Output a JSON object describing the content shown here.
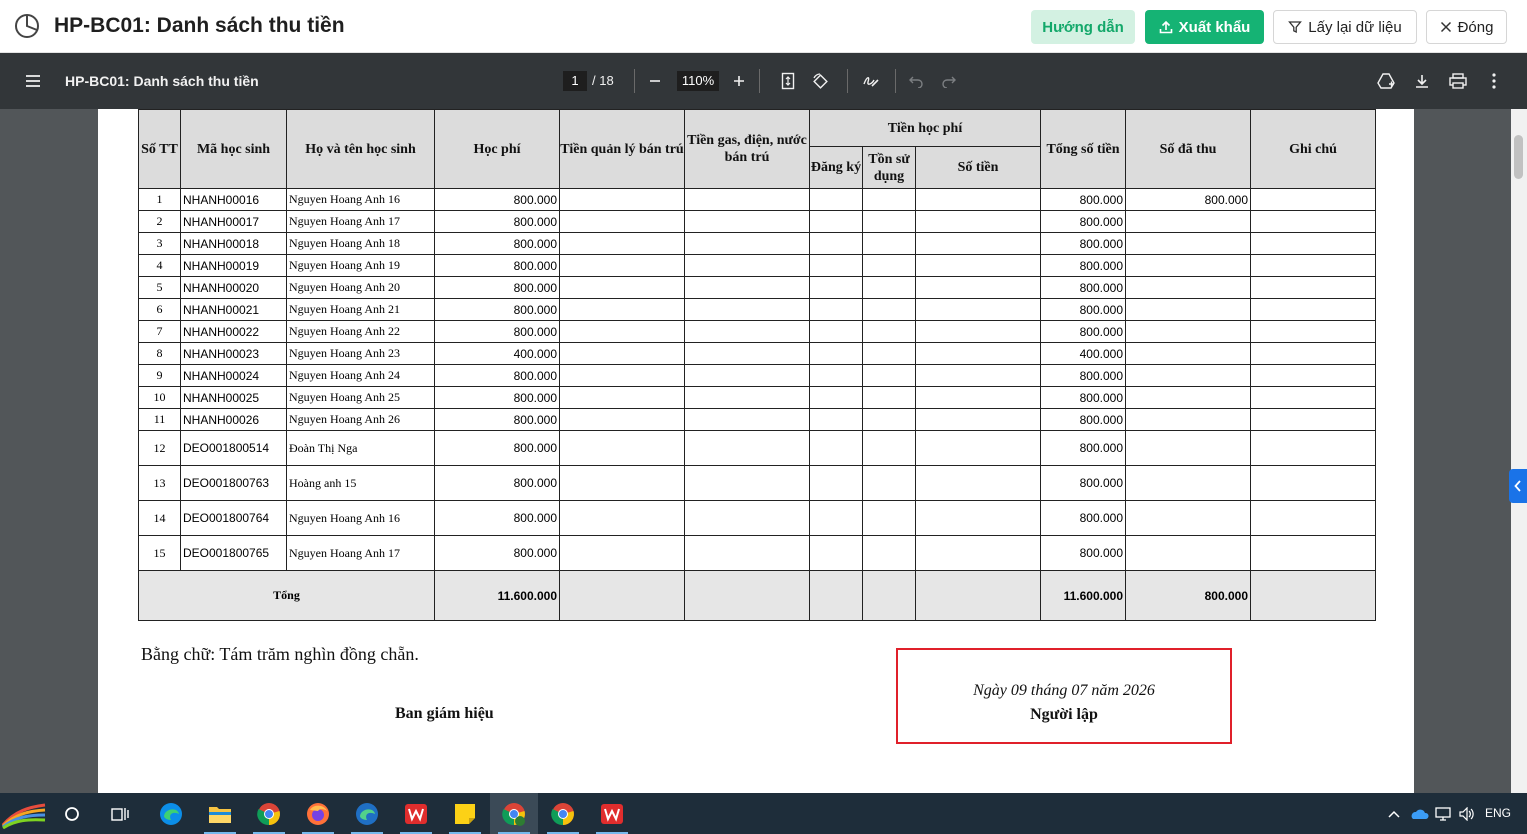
{
  "app": {
    "title": "HP-BC01: Danh sách thu tiền",
    "buttons": {
      "guide": "Hướng dẫn",
      "export": "Xuất khẩu",
      "reload": "Lấy lại dữ liệu",
      "close": "Đóng"
    },
    "colors": {
      "accent": "#15b374",
      "accent_light": "#d3f1e2"
    }
  },
  "viewer": {
    "doc_title": "HP-BC01: Danh sách thu tiền",
    "current_page": "1",
    "page_total": "/ 18",
    "zoom": "110%"
  },
  "table": {
    "headers": {
      "stt": "Số TT",
      "code": "Mã học sinh",
      "name": "Họ và tên học sinh",
      "tuition": "Học phí",
      "boarding": "Tiền quản lý bán trú",
      "gas": "Tiền gas, điện, nước bán trú",
      "study_fee": "Tiền học phí",
      "registered": "Đăng ký",
      "remaining": "Tồn sử dụng",
      "amount": "Số tiền",
      "total": "Tổng số tiền",
      "collected": "Số đã thu",
      "note": "Ghi chú"
    },
    "rows": [
      {
        "stt": "1",
        "code": "NHANH00016",
        "name": "Nguyen Hoang Anh 16",
        "tuition": "800.000",
        "total": "800.000",
        "collected": "800.000"
      },
      {
        "stt": "2",
        "code": "NHANH00017",
        "name": "Nguyen Hoang Anh 17",
        "tuition": "800.000",
        "total": "800.000",
        "collected": ""
      },
      {
        "stt": "3",
        "code": "NHANH00018",
        "name": "Nguyen Hoang Anh 18",
        "tuition": "800.000",
        "total": "800.000",
        "collected": ""
      },
      {
        "stt": "4",
        "code": "NHANH00019",
        "name": "Nguyen Hoang Anh 19",
        "tuition": "800.000",
        "total": "800.000",
        "collected": ""
      },
      {
        "stt": "5",
        "code": "NHANH00020",
        "name": "Nguyen Hoang Anh 20",
        "tuition": "800.000",
        "total": "800.000",
        "collected": ""
      },
      {
        "stt": "6",
        "code": "NHANH00021",
        "name": "Nguyen Hoang Anh 21",
        "tuition": "800.000",
        "total": "800.000",
        "collected": ""
      },
      {
        "stt": "7",
        "code": "NHANH00022",
        "name": "Nguyen Hoang Anh 22",
        "tuition": "800.000",
        "total": "800.000",
        "collected": ""
      },
      {
        "stt": "8",
        "code": "NHANH00023",
        "name": "Nguyen Hoang Anh 23",
        "tuition": "400.000",
        "total": "400.000",
        "collected": ""
      },
      {
        "stt": "9",
        "code": "NHANH00024",
        "name": "Nguyen Hoang Anh 24",
        "tuition": "800.000",
        "total": "800.000",
        "collected": ""
      },
      {
        "stt": "10",
        "code": "NHANH00025",
        "name": "Nguyen Hoang Anh 25",
        "tuition": "800.000",
        "total": "800.000",
        "collected": ""
      },
      {
        "stt": "11",
        "code": "NHANH00026",
        "name": "Nguyen Hoang Anh 26",
        "tuition": "800.000",
        "total": "800.000",
        "collected": ""
      },
      {
        "stt": "12",
        "code": "DEO001800514",
        "name": "Đoàn Thị Nga",
        "tuition": "800.000",
        "total": "800.000",
        "collected": ""
      },
      {
        "stt": "13",
        "code": "DEO001800763",
        "name": "Hoàng anh 15",
        "tuition": "800.000",
        "total": "800.000",
        "collected": ""
      },
      {
        "stt": "14",
        "code": "DEO001800764",
        "name": "Nguyen Hoang Anh 16",
        "tuition": "800.000",
        "total": "800.000",
        "collected": ""
      },
      {
        "stt": "15",
        "code": "DEO001800765",
        "name": "Nguyen Hoang Anh 17",
        "tuition": "800.000",
        "total": "800.000",
        "collected": ""
      }
    ],
    "totals": {
      "label": "Tổng",
      "tuition": "11.600.000",
      "total": "11.600.000",
      "collected": "800.000"
    }
  },
  "footer": {
    "amount_in_words": "Bằng chữ: Tám trăm nghìn đồng chẵn.",
    "board": "Ban giám hiệu",
    "date": "Ngày 09 tháng 07 năm 2026",
    "preparer": "Người lập"
  },
  "taskbar": {
    "language": "ENG",
    "apps": [
      "start",
      "search",
      "task-view",
      "edge",
      "file-explorer",
      "chrome",
      "firefox",
      "edge-dev",
      "wps",
      "sticky-notes",
      "chrome-profile",
      "chrome",
      "wps"
    ]
  }
}
